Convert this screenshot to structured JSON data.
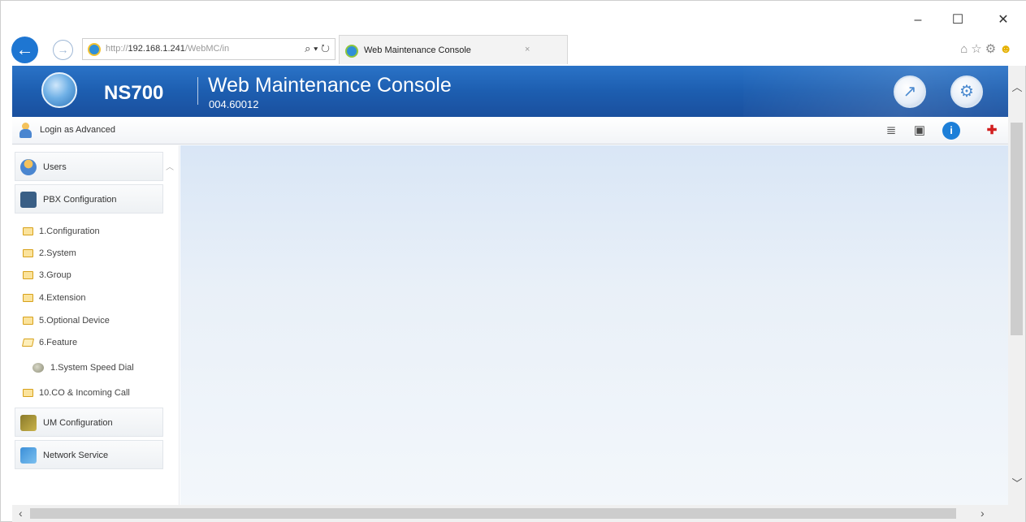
{
  "browser": {
    "url_prefix": "http://",
    "url_host": "192.168.1.241",
    "url_path": "/WebMC/in",
    "address_tools": "⌕ ▾ ↻",
    "tab_title": "Web Maintenance Console",
    "tab_close": "×",
    "window_controls": {
      "minimize": "–",
      "maximize": "☐",
      "close": "✕"
    },
    "back_glyph": "←",
    "forward_glyph": "→",
    "right_icons": {
      "home": "⌂",
      "favorites": "☆",
      "tools": "⚙",
      "feedback": "☻"
    }
  },
  "banner": {
    "model": "NS700",
    "title": "Web Maintenance Console",
    "version": "004.60012",
    "tool_button_glyph": "↗",
    "settings_button_glyph": "⚙"
  },
  "toolbar": {
    "login_text": "Login as Advanced",
    "icons": {
      "list": "≣",
      "save": "▣",
      "info": "i",
      "exit": "✚"
    }
  },
  "sidebar": {
    "sections": {
      "users": "Users",
      "pbx": "PBX Configuration",
      "um": "UM Configuration",
      "network": "Network Service"
    },
    "tree": [
      "1.Configuration",
      "2.System",
      "3.Group",
      "4.Extension",
      "5.Optional Device",
      "6.Feature",
      "1.System Speed Dial",
      "10.CO & Incoming Call"
    ],
    "collapse_glyph": "︿"
  },
  "scrollbars": {
    "up": "︿",
    "down": "﹀",
    "left": "‹",
    "right": "›"
  },
  "colors": {
    "banner": "#1d5eb0",
    "accent": "#1e76d2",
    "content_bg": "#e3ecf7"
  }
}
